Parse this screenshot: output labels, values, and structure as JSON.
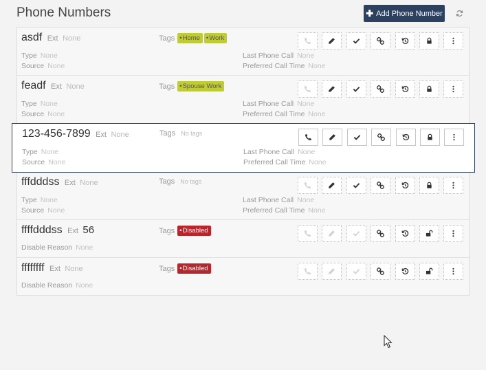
{
  "page": {
    "title": "Phone Numbers",
    "add_button": "Add Phone Number"
  },
  "labels": {
    "ext": "Ext",
    "tags": "Tags",
    "type": "Type",
    "source": "Source",
    "last_call": "Last Phone Call",
    "preferred": "Preferred Call Time",
    "disable_reason": "Disable Reason",
    "no_tags": "No tags"
  },
  "colors": {
    "primary": "#2c4160",
    "tag_green": "#c0cc35",
    "tag_red": "#b3272d"
  },
  "actions": [
    "phone-icon",
    "pencil-icon",
    "check-icon",
    "link-icon",
    "history-icon",
    "lock-icon",
    "more-icon"
  ],
  "rows": [
    {
      "number": "asdf",
      "ext": "None",
      "tags": [
        {
          "label": "Home",
          "color": "green"
        },
        {
          "label": "Work",
          "color": "green"
        }
      ],
      "type": "None",
      "source": "None",
      "last_call": "None",
      "preferred": "None"
    },
    {
      "number": "feadf",
      "ext": "None",
      "tags": [
        {
          "label": "Spouse Work",
          "color": "green"
        }
      ],
      "type": "None",
      "source": "None",
      "last_call": "None",
      "preferred": "None"
    },
    {
      "number": "123-456-7899",
      "ext": "None",
      "type": "None",
      "source": "None",
      "last_call": "None",
      "preferred": "None"
    },
    {
      "number": "fffdddss",
      "ext": "None",
      "type": "None",
      "source": "None",
      "last_call": "None",
      "preferred": "None"
    },
    {
      "number": "ffffdddss",
      "ext": "56",
      "tags": [
        {
          "label": "Disabled",
          "color": "red"
        }
      ],
      "disable_reason": "None"
    },
    {
      "number": "ffffffff",
      "ext": "None",
      "tags": [
        {
          "label": "Disabled",
          "color": "red"
        }
      ],
      "disable_reason": "None"
    }
  ]
}
